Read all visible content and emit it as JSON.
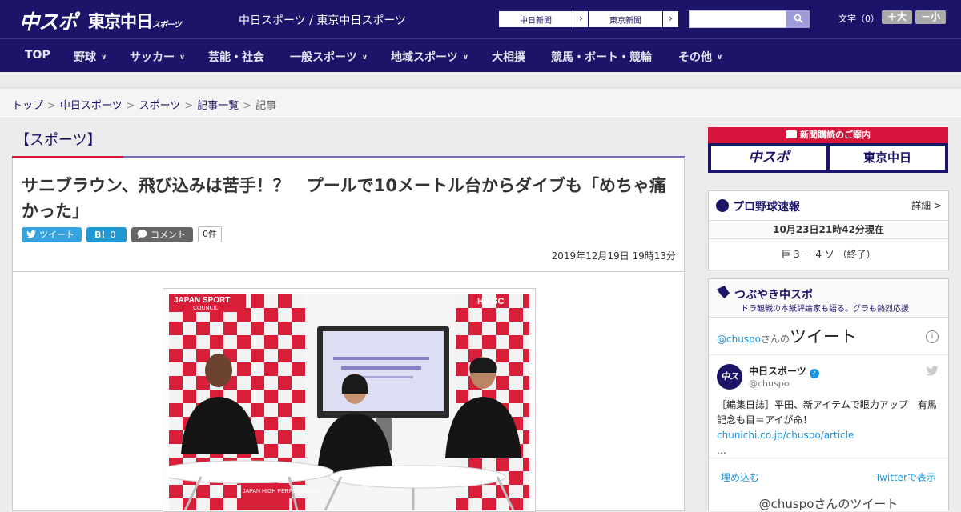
{
  "header": {
    "logo_chuspo": "中スポ",
    "logo_tokyo": "東京中日",
    "logo_tokyo_small": "スポーツ",
    "site_name": "中日スポーツ / 東京中日スポーツ",
    "paper_buttons": [
      "中日新聞",
      "東京新聞"
    ],
    "arrow": "›",
    "search_placeholder": "",
    "font_label": "文字（0）",
    "font_bigger": "＋大",
    "font_smaller": "－小"
  },
  "nav": {
    "items": [
      {
        "label": "TOP"
      },
      {
        "label": "野球"
      },
      {
        "label": "サッカー"
      },
      {
        "label": "芸能・社会"
      },
      {
        "label": "一般スポーツ"
      },
      {
        "label": "地域スポーツ"
      },
      {
        "label": "大相撲"
      },
      {
        "label": "競馬・ボート・競輪"
      },
      {
        "label": "その他"
      }
    ],
    "chevron": "∨"
  },
  "breadcrumb": {
    "items": [
      "トップ",
      "中日スポーツ",
      "スポーツ",
      "記事一覧",
      "記事"
    ],
    "separator": ">"
  },
  "article": {
    "section": "【スポーツ】",
    "headline": "サニブラウン、飛び込みは苦手！？　プールで10メートル台からダイブも「めちゃ痛かった」",
    "tweet_label": "ツイート",
    "hatena_label": "B!",
    "hatena_count": "0",
    "comment_label": "コメント",
    "comment_count": "0件",
    "date": "2019年12月19日 19時13分",
    "photo": {
      "banner_left": "JAPAN SPORT",
      "banner_left2": "COUNCIL",
      "logo": "HP SC",
      "table_text": "JAPAN HIGH PERFORMANCE"
    }
  },
  "sidebar": {
    "promo": {
      "title": "新聞購読のご案内",
      "left": "中スポ",
      "right": "東京中日"
    },
    "baseball": {
      "title": "プロ野球速報",
      "more": "詳細 >",
      "time": "10月23日21時42分現在",
      "score": "巨 3 － 4 ソ （終了）"
    },
    "tweets": {
      "title": "つぶやき中スポ",
      "subtitle": "ドラ観戦の本紙評論家も語る。グラも熱烈応援",
      "widget_handle": "@chuspo",
      "widget_san": "さんの",
      "widget_title": "ツイート",
      "info": "i",
      "avatar_text": "中ス",
      "user_name": "中日スポーツ",
      "check": "✓",
      "user_handle": "@chuspo",
      "text": "［編集日誌］平田、新アイテムで眼力アップ　有馬記念も目＝アイが命！",
      "link": "chunichi.co.jp/chuspo/article",
      "ellipsis": "…",
      "embed": "埋め込む",
      "view_on_twitter": "Twitterで表示",
      "next_heading": "@chuspoさんのツイート"
    }
  }
}
